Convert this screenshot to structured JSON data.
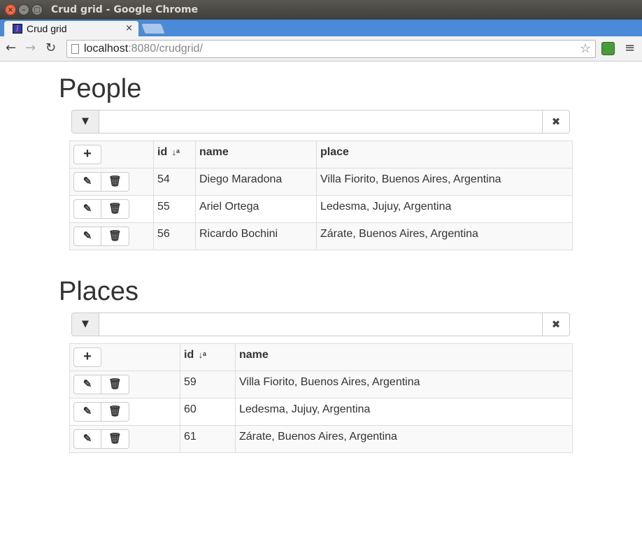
{
  "window": {
    "title": "Crud grid - Google Chrome"
  },
  "tab": {
    "title": "Crud grid",
    "close": "×"
  },
  "address": {
    "host": "localhost",
    "rest": ":8080/crudgrid/"
  },
  "icons": {
    "close": "×",
    "minimize": "–",
    "maximize": "□",
    "back": "←",
    "forward": "→",
    "reload": "↻",
    "star": "☆",
    "menu": "≡",
    "filter": "▼",
    "clear": "✖",
    "add": "+",
    "edit": "✎",
    "delete": "🗑",
    "sort": "↓ᵃ"
  },
  "people": {
    "title": "People",
    "filter_value": "",
    "headers": {
      "id": "id",
      "name": "name",
      "place": "place"
    },
    "rows": [
      {
        "id": "54",
        "name": "Diego Maradona",
        "place": "Villa Fiorito, Buenos Aires, Argentina"
      },
      {
        "id": "55",
        "name": "Ariel Ortega",
        "place": "Ledesma, Jujuy, Argentina"
      },
      {
        "id": "56",
        "name": "Ricardo Bochini",
        "place": "Zárate, Buenos Aires, Argentina"
      }
    ]
  },
  "places": {
    "title": "Places",
    "filter_value": "",
    "headers": {
      "id": "id",
      "name": "name"
    },
    "rows": [
      {
        "id": "59",
        "name": "Villa Fiorito, Buenos Aires, Argentina"
      },
      {
        "id": "60",
        "name": "Ledesma, Jujuy, Argentina"
      },
      {
        "id": "61",
        "name": "Zárate, Buenos Aires, Argentina"
      }
    ]
  }
}
